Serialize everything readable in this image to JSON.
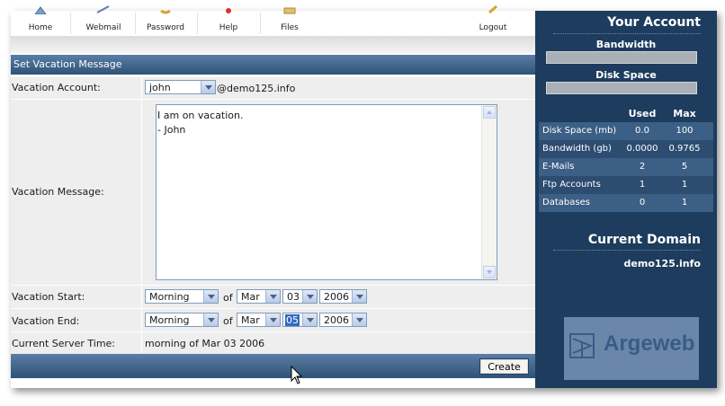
{
  "nav": {
    "items": [
      {
        "label": "Home",
        "icon": "home-icon"
      },
      {
        "label": "Webmail",
        "icon": "webmail-icon"
      },
      {
        "label": "Password",
        "icon": "password-icon"
      },
      {
        "label": "Help",
        "icon": "help-icon"
      },
      {
        "label": "Files",
        "icon": "files-icon"
      },
      {
        "label": "Logout",
        "icon": "logout-icon"
      }
    ]
  },
  "form": {
    "title": "Set Vacation Message",
    "account_label": "Vacation Account:",
    "account_value": "john",
    "domain_suffix": "@demo125.info",
    "message_label": "Vacation Message:",
    "message_text": "I am on vacation.\n- John",
    "start_label": "Vacation Start:",
    "start": {
      "period": "Morning",
      "of": "of",
      "month": "Mar",
      "day": "03",
      "year": "2006"
    },
    "end_label": "Vacation End:",
    "end": {
      "period": "Morning",
      "of": "of",
      "month": "Mar",
      "day": "05",
      "year": "2006"
    },
    "server_time_label": "Current Server Time:",
    "server_time_value": "morning of Mar 03 2006",
    "create_button": "Create"
  },
  "sidebar": {
    "title": "Your Account",
    "bandwidth_label": "Bandwidth",
    "disk_space_label": "Disk Space",
    "bandwidth_usage": 0.0,
    "disk_usage": 0.0,
    "stats_headers": {
      "used": "Used",
      "max": "Max"
    },
    "stats": [
      {
        "name": "Disk Space (mb)",
        "used": "0.0",
        "max": "100"
      },
      {
        "name": "Bandwidth (gb)",
        "used": "0.0000",
        "max": "0.9765"
      },
      {
        "name": "E-Mails",
        "used": "2",
        "max": "5"
      },
      {
        "name": "Ftp Accounts",
        "used": "1",
        "max": "1"
      },
      {
        "name": "Databases",
        "used": "0",
        "max": "1"
      }
    ],
    "current_domain_title": "Current Domain",
    "current_domain": "demo125.info",
    "logo_text": "Argeweb"
  },
  "colors": {
    "header_blue": "#2f5277",
    "sidebar_bg": "#1d3c5e",
    "row_bg": "#eeeeee"
  }
}
